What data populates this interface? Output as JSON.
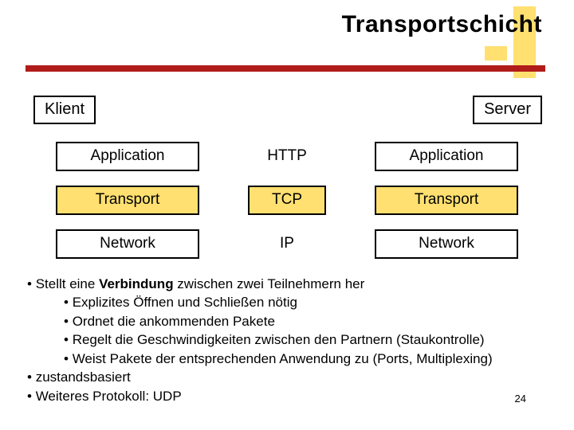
{
  "title": "Transportschicht",
  "hosts": {
    "left": "Klient",
    "right": "Server"
  },
  "layers": {
    "left": [
      "Application",
      "Transport",
      "Network"
    ],
    "mid": [
      "HTTP",
      "TCP",
      "IP"
    ],
    "right": [
      "Application",
      "Transport",
      "Network"
    ]
  },
  "highlight_row": 1,
  "bullets": {
    "b0_pre": "Stellt eine ",
    "b0_bold": "Verbindung",
    "b0_post": " zwischen zwei Teilnehmern her",
    "sub": [
      "Explizites Öffnen und Schließen nötig",
      "Ordnet die ankommenden Pakete",
      "Regelt die Geschwindigkeiten zwischen den Partnern (Staukontrolle)",
      "Weist Pakete der entsprechenden Anwendung zu (Ports, Multiplexing)"
    ],
    "b1": "zustandsbasiert",
    "b2": "Weiteres Protokoll: UDP"
  },
  "page_number": "24"
}
